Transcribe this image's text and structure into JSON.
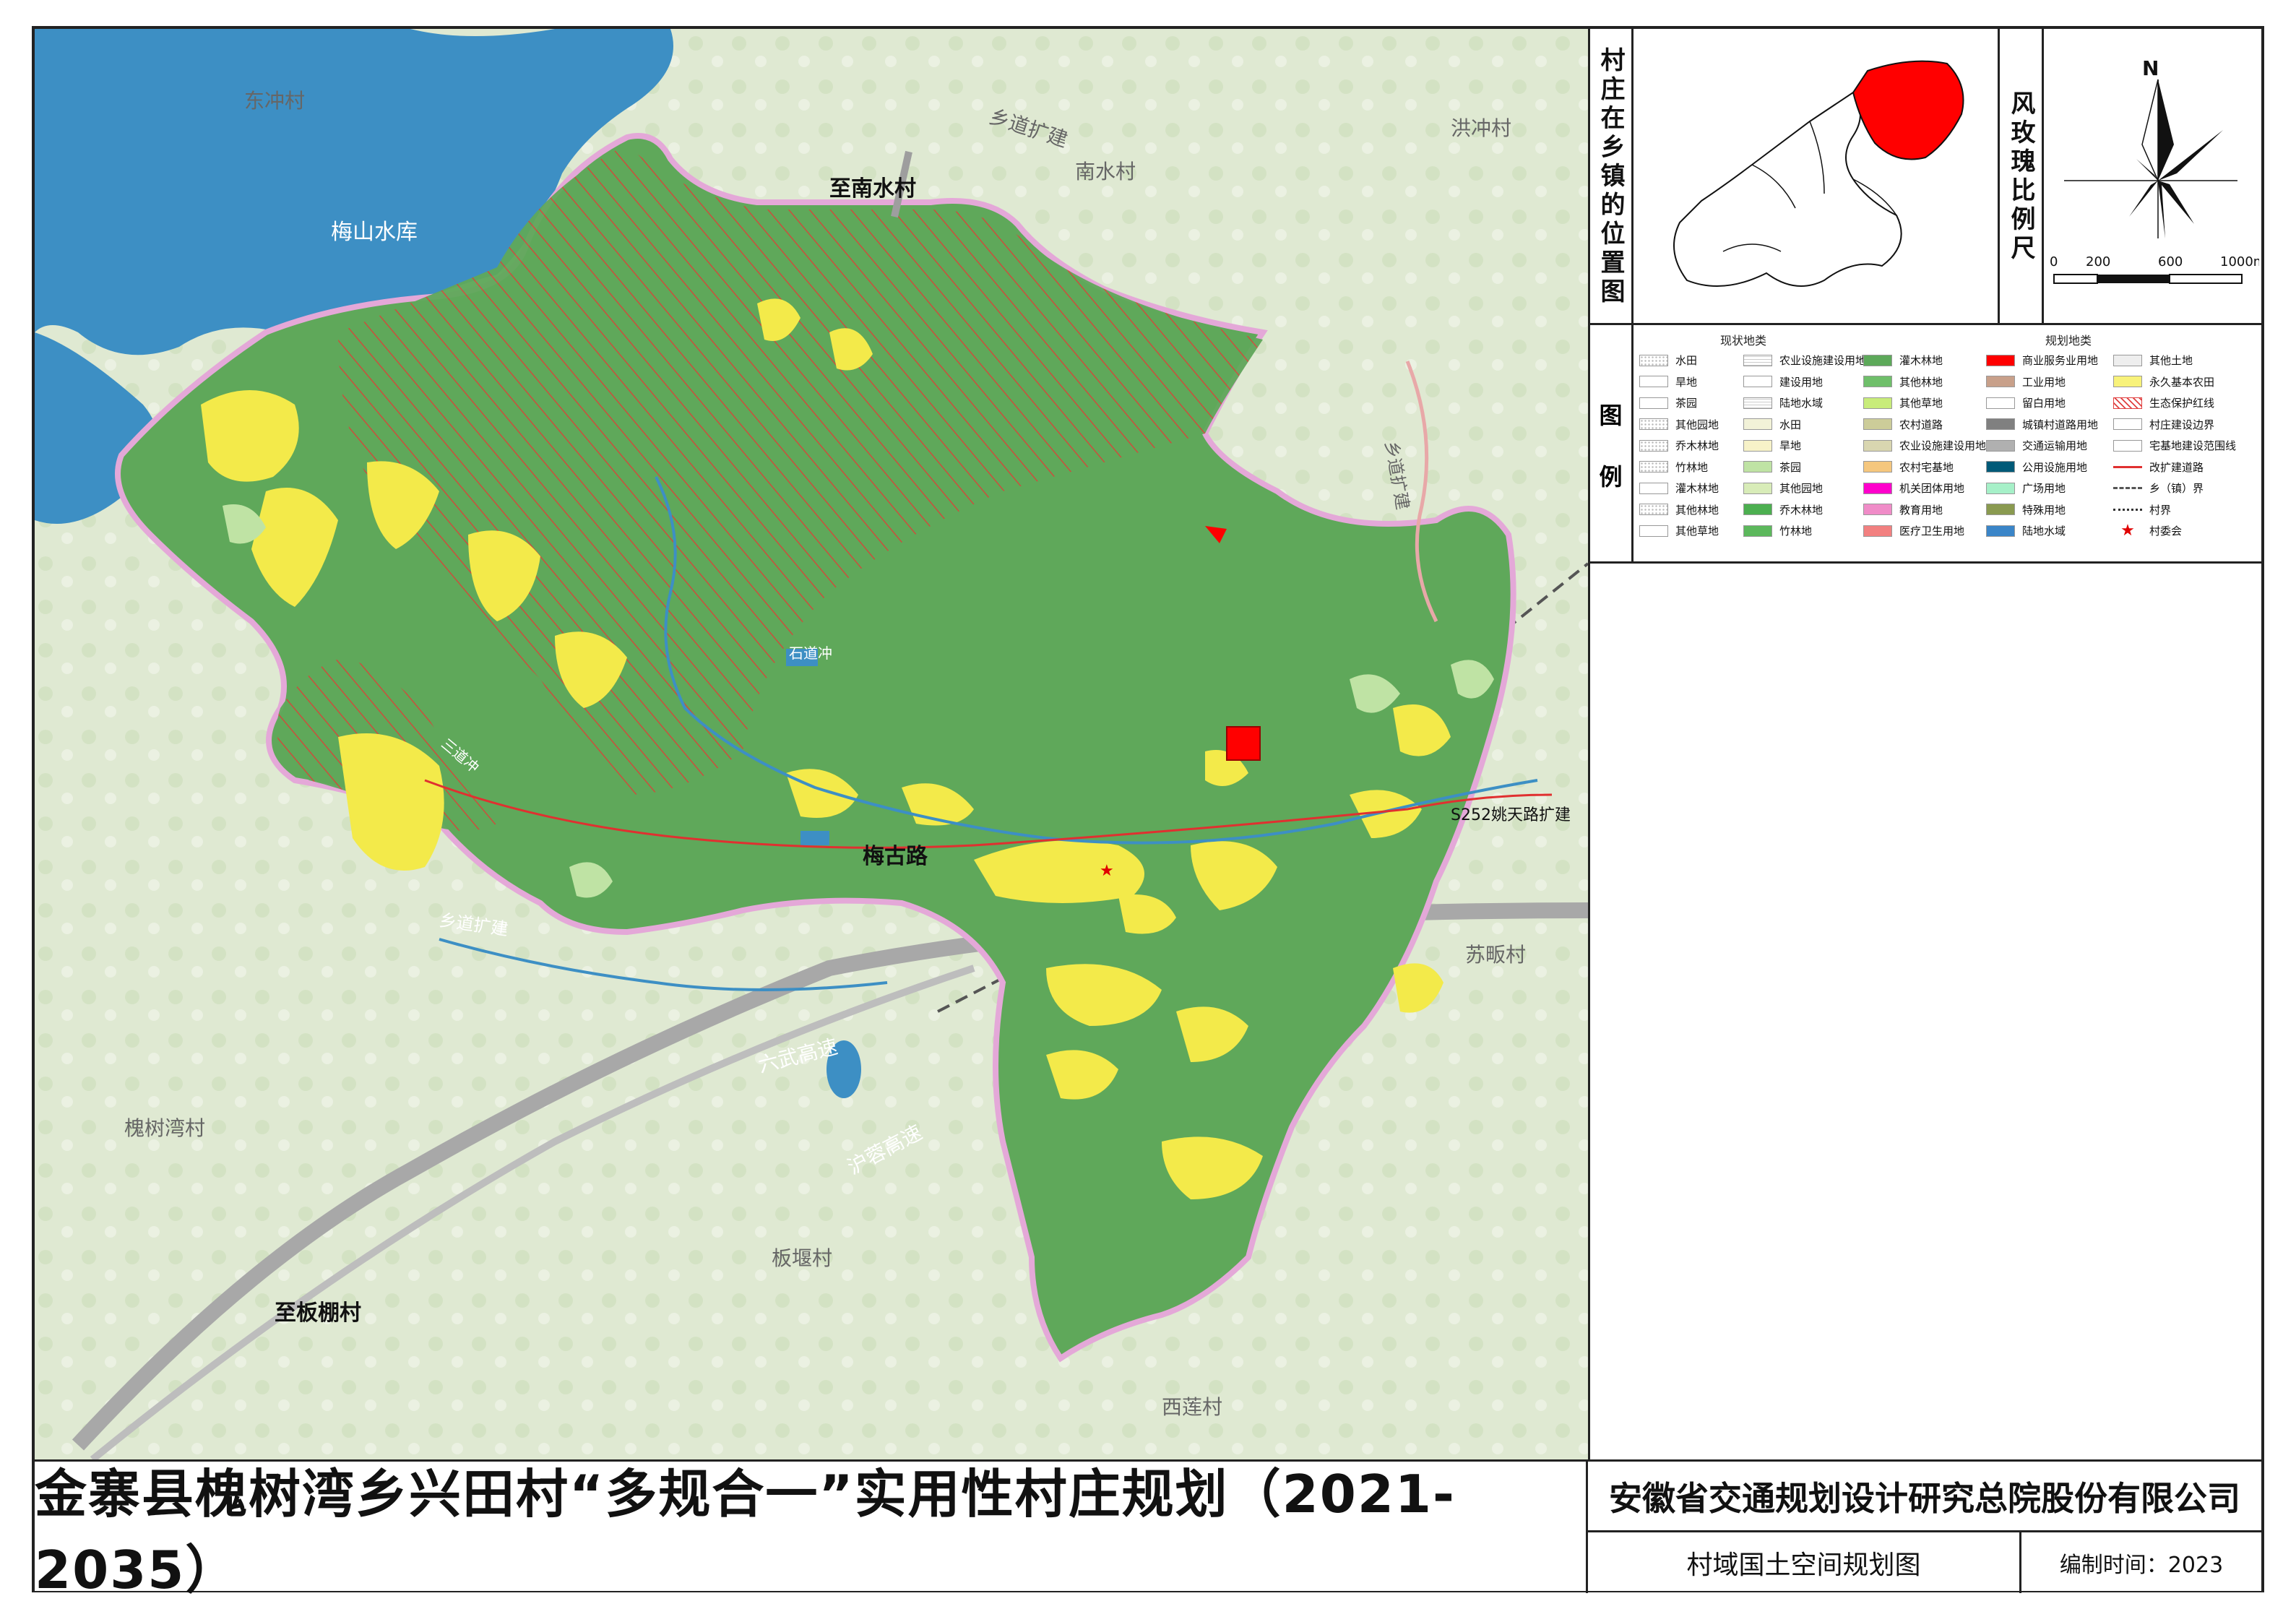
{
  "title": "金寨县槐树湾乡兴田村“多规合一”实用性村庄规划（2021-2035）",
  "company": "安徽省交通规划设计研究总院股份有限公司",
  "drawing_name": "村域国土空间规划图",
  "date": "编制时间：2023",
  "location_map_label": "村庄在乡镇的位置图",
  "compass_label": "风玫瑰比例尺",
  "north": "N",
  "scale_ticks": [
    "0",
    "200",
    "600",
    "1000m"
  ],
  "legend": {
    "heading": "图例",
    "heading_chars": [
      "图",
      "例"
    ],
    "current_header": "现状地类",
    "planned_header": "规划地类",
    "columns": [
      [
        {
          "label": "水田",
          "style": "dots",
          "color": "#ffffff"
        },
        {
          "label": "旱地",
          "style": "fill",
          "color": "#ffffff"
        },
        {
          "label": "茶园",
          "style": "fill",
          "color": "#ffffff"
        },
        {
          "label": "其他园地",
          "style": "dots",
          "color": "#ffffff"
        },
        {
          "label": "乔木林地",
          "style": "dots",
          "color": "#ffffff"
        },
        {
          "label": "竹林地",
          "style": "dots",
          "color": "#ffffff"
        },
        {
          "label": "灌木林地",
          "style": "fill",
          "color": "#ffffff"
        },
        {
          "label": "其他林地",
          "style": "dots",
          "color": "#ffffff"
        },
        {
          "label": "其他草地",
          "style": "fill",
          "color": "#ffffff"
        }
      ],
      [
        {
          "label": "农业设施建设用地",
          "style": "grid",
          "color": "#ffffff"
        },
        {
          "label": "建设用地",
          "style": "fill",
          "color": "#ffffff"
        },
        {
          "label": "陆地水域",
          "style": "grid",
          "color": "#ffffff"
        },
        {
          "label": "水田",
          "style": "fill",
          "color": "#f2f2d8"
        },
        {
          "label": "旱地",
          "style": "fill",
          "color": "#f7f2c8"
        },
        {
          "label": "茶园",
          "style": "fill",
          "color": "#bfe3a4"
        },
        {
          "label": "其他园地",
          "style": "fill",
          "color": "#d8ecb8"
        },
        {
          "label": "乔木林地",
          "style": "fill",
          "color": "#4caf50"
        },
        {
          "label": "竹林地",
          "style": "fill",
          "color": "#5cb85c"
        }
      ],
      [
        {
          "label": "灌木林地",
          "style": "fill",
          "color": "#5da95a"
        },
        {
          "label": "其他林地",
          "style": "fill",
          "color": "#6fbf6a"
        },
        {
          "label": "其他草地",
          "style": "fill",
          "color": "#c8ec7a"
        },
        {
          "label": "农村道路",
          "style": "fill",
          "color": "#cccc99"
        },
        {
          "label": "农业设施建设用地",
          "style": "fill",
          "color": "#d9d6b0"
        },
        {
          "label": "农村宅基地",
          "style": "fill",
          "color": "#f5c77e"
        },
        {
          "label": "机关团体用地",
          "style": "fill",
          "color": "#ff00cc"
        },
        {
          "label": "教育用地",
          "style": "fill",
          "color": "#f08cc8"
        },
        {
          "label": "医疗卫生用地",
          "style": "fill",
          "color": "#f28080"
        }
      ],
      [
        {
          "label": "商业服务业用地",
          "style": "fill",
          "color": "#ff0000"
        },
        {
          "label": "工业用地",
          "style": "fill",
          "color": "#c8a08a"
        },
        {
          "label": "留白用地",
          "style": "fill",
          "color": "#ffffff"
        },
        {
          "label": "城镇村道路用地",
          "style": "fill",
          "color": "#808080"
        },
        {
          "label": "交通运输用地",
          "style": "fill",
          "color": "#b0b0b0"
        },
        {
          "label": "公用设施用地",
          "style": "fill",
          "color": "#005a78"
        },
        {
          "label": "广场用地",
          "style": "fill",
          "color": "#a6f0c8"
        },
        {
          "label": "特殊用地",
          "style": "fill",
          "color": "#8a9a50"
        },
        {
          "label": "陆地水域",
          "style": "fill",
          "color": "#3a85c8"
        }
      ],
      [
        {
          "label": "其他土地",
          "style": "fill",
          "color": "#eeeeee"
        },
        {
          "label": "永久基本农田",
          "style": "fill",
          "color": "#f8f27a"
        },
        {
          "label": "生态保护红线",
          "style": "hatch",
          "color": "#e04040"
        },
        {
          "label": "村庄建设边界",
          "style": "fill",
          "color": "#ffffff"
        },
        {
          "label": "宅基地建设范围线",
          "style": "fill",
          "color": "#ffffff"
        },
        {
          "label": "改扩建道路",
          "style": "line",
          "color": "#e03030"
        },
        {
          "label": "乡（镇）界",
          "style": "dash",
          "color": "#555555"
        },
        {
          "label": "村界",
          "style": "dot",
          "color": "#333333"
        },
        {
          "label": "村委会",
          "style": "star",
          "color": "#e00000"
        }
      ]
    ]
  },
  "map_labels": {
    "dongchong": "东冲村",
    "meishan_reservoir": "梅山水库",
    "xiang_road_top": "乡道扩建",
    "to_nanshui": "至南水村",
    "nanshui": "南水村",
    "hongchong": "洪冲村",
    "xiang_road_right": "乡道扩建",
    "shidaochong": "石道冲",
    "sandaochong": "三道冲",
    "meigu_road": "梅古路",
    "s252": "S252姚天路扩建",
    "xiang_road_left": "乡道扩建",
    "sufan": "苏畈村",
    "liuwu": "六武高速",
    "hurong": "沪蓉高速",
    "huaishuwan": "槐树湾村",
    "banyan": "板堰村",
    "to_banpeng": "至板棚村",
    "xilian": "西莲村"
  },
  "colors": {
    "forest": "#5fa85a",
    "hatch": "#d04a3a",
    "farmland": "#f3ea4a",
    "water": "#3d8fc4",
    "boundary": "#e4a8d8",
    "background": "#dfe9d2"
  }
}
